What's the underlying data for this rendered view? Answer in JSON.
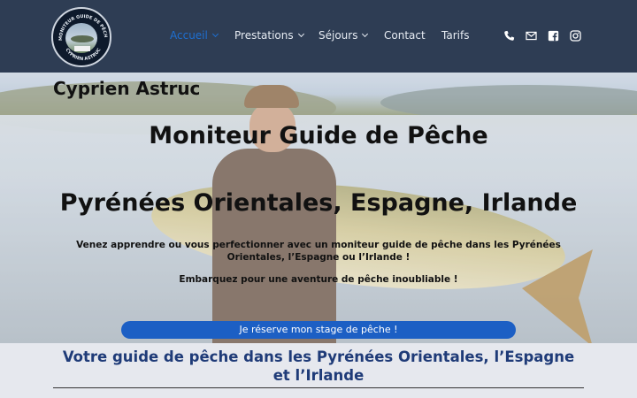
{
  "logo": {
    "ring_top": "MONITEUR GUIDE DE PÊCHE",
    "ring_bottom": "CYPRIEN ASTRUC"
  },
  "nav": {
    "items": [
      {
        "label": "Accueil",
        "dropdown": true,
        "active": true
      },
      {
        "label": "Prestations",
        "dropdown": true,
        "active": false
      },
      {
        "label": "Séjours",
        "dropdown": true,
        "active": false
      },
      {
        "label": "Contact",
        "dropdown": false,
        "active": false
      },
      {
        "label": "Tarifs",
        "dropdown": false,
        "active": false
      }
    ]
  },
  "header_icons": [
    "phone-icon",
    "mail-icon",
    "facebook-icon",
    "instagram-icon"
  ],
  "hero": {
    "brand": "Cyprien Astruc",
    "title_line1": "Moniteur Guide de Pêche",
    "title_line2": "Pyrénées Orientales, Espagne, Irlande",
    "paragraph1": "Venez apprendre ou vous perfectionner avec un moniteur guide de pêche dans les Pyrénées Orientales, l’Espagne ou l’Irlande !",
    "paragraph2": "Embarquez pour une aventure de pêche inoubliable !",
    "cta_label": "Je réserve mon stage de pêche !"
  },
  "section": {
    "title": "Votre guide de pêche dans les Pyrénées Orientales, l’Espagne et l’Irlande"
  },
  "colors": {
    "header_bg": "#2e3d54",
    "accent": "#1e6fd1",
    "cta_bg": "#1c5fc4",
    "section_title": "#1f3b78"
  }
}
